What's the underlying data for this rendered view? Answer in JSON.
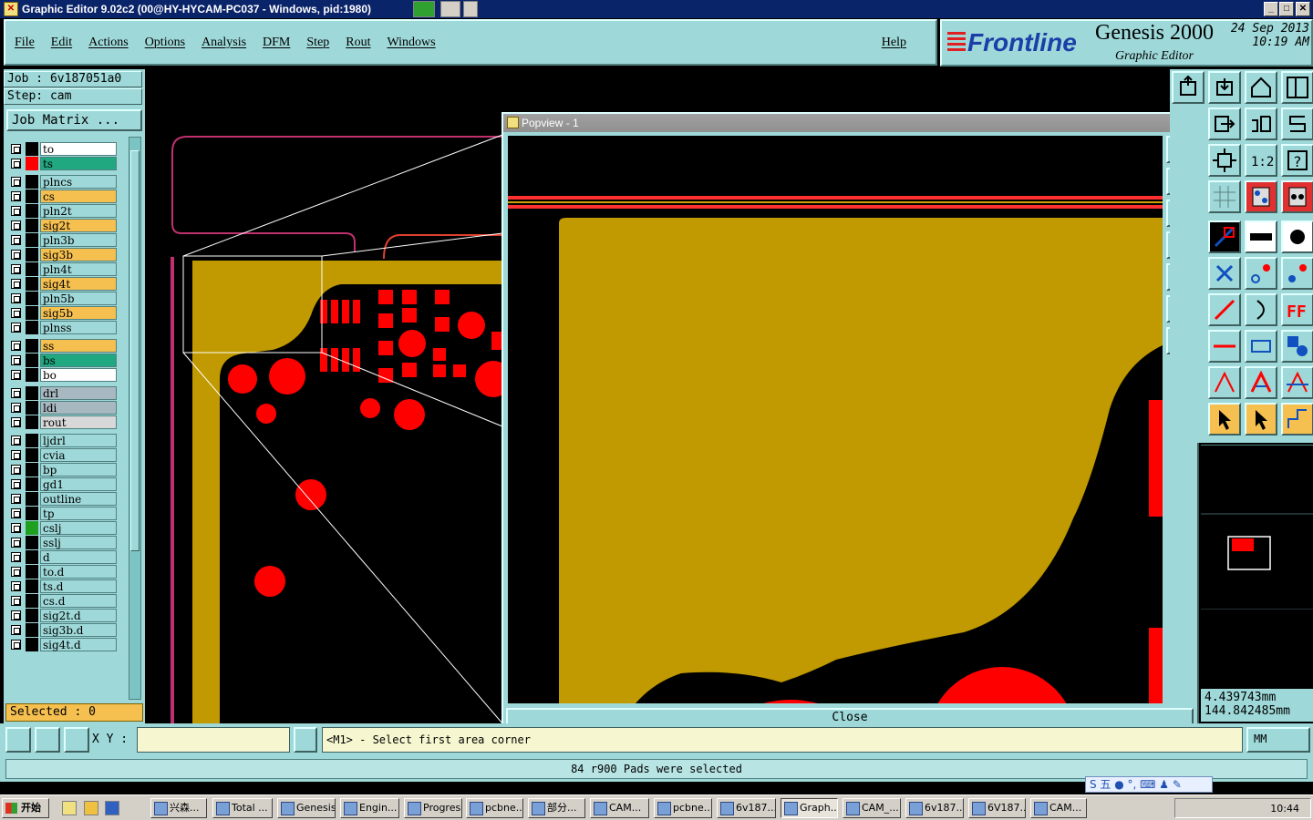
{
  "window": {
    "title": "Graphic Editor 9.02c2 (00@HY-HYCAM-PC037 - Windows, pid:1980)"
  },
  "menu": {
    "items": [
      "File",
      "Edit",
      "Actions",
      "Options",
      "Analysis",
      "DFM",
      "Step",
      "Rout",
      "Windows"
    ],
    "help": "Help"
  },
  "brand": {
    "logo": "Frontline",
    "product": "Genesis 2000",
    "subtitle": "Graphic Editor",
    "date": "24 Sep 2013",
    "time": "10:19 AM"
  },
  "job": {
    "job_label": "Job : 6v187051a0",
    "step_label": "Step: cam",
    "matrix_button": "Job Matrix ..."
  },
  "layers": [
    {
      "name": "to",
      "color": "#ffffff",
      "swatch": "#000000"
    },
    {
      "name": "ts",
      "color": "#20a880",
      "swatch": "#ff0000"
    },
    {
      "name": "plncs",
      "color": "#9ed8d8",
      "swatch": "#000000"
    },
    {
      "name": "cs",
      "color": "#f6c050",
      "swatch": "#000000"
    },
    {
      "name": "pln2t",
      "color": "#9ed8d8",
      "swatch": "#000000"
    },
    {
      "name": "sig2t",
      "color": "#f6c050",
      "swatch": "#000000"
    },
    {
      "name": "pln3b",
      "color": "#9ed8d8",
      "swatch": "#000000"
    },
    {
      "name": "sig3b",
      "color": "#f6c050",
      "swatch": "#000000"
    },
    {
      "name": "pln4t",
      "color": "#9ed8d8",
      "swatch": "#000000"
    },
    {
      "name": "sig4t",
      "color": "#f6c050",
      "swatch": "#000000"
    },
    {
      "name": "pln5b",
      "color": "#9ed8d8",
      "swatch": "#000000"
    },
    {
      "name": "sig5b",
      "color": "#f6c050",
      "swatch": "#000000"
    },
    {
      "name": "plnss",
      "color": "#9ed8d8",
      "swatch": "#000000"
    },
    {
      "name": "ss",
      "color": "#f6c050",
      "swatch": "#000000"
    },
    {
      "name": "bs",
      "color": "#20a880",
      "swatch": "#000000"
    },
    {
      "name": "bo",
      "color": "#ffffff",
      "swatch": "#000000"
    },
    {
      "name": "drl",
      "color": "#a8b8c0",
      "swatch": "#000000"
    },
    {
      "name": "ldi",
      "color": "#a8b8c0",
      "swatch": "#000000"
    },
    {
      "name": "rout",
      "color": "#d8d8d8",
      "swatch": "#000000"
    },
    {
      "name": "ljdrl",
      "color": "#9ed8d8",
      "swatch": "#000000"
    },
    {
      "name": "cvia",
      "color": "#9ed8d8",
      "swatch": "#000000"
    },
    {
      "name": "bp",
      "color": "#9ed8d8",
      "swatch": "#000000"
    },
    {
      "name": "gd1",
      "color": "#9ed8d8",
      "swatch": "#000000"
    },
    {
      "name": "outline",
      "color": "#9ed8d8",
      "swatch": "#000000"
    },
    {
      "name": "tp",
      "color": "#9ed8d8",
      "swatch": "#000000"
    },
    {
      "name": "cslj",
      "color": "#9ed8d8",
      "swatch": "#20a020"
    },
    {
      "name": "sslj",
      "color": "#9ed8d8",
      "swatch": "#000000"
    },
    {
      "name": "d",
      "color": "#9ed8d8",
      "swatch": "#000000"
    },
    {
      "name": "to.d",
      "color": "#9ed8d8",
      "swatch": "#000000"
    },
    {
      "name": "ts.d",
      "color": "#9ed8d8",
      "swatch": "#000000"
    },
    {
      "name": "cs.d",
      "color": "#9ed8d8",
      "swatch": "#000000"
    },
    {
      "name": "sig2t.d",
      "color": "#9ed8d8",
      "swatch": "#000000"
    },
    {
      "name": "sig3b.d",
      "color": "#9ed8d8",
      "swatch": "#000000"
    },
    {
      "name": "sig4t.d",
      "color": "#9ed8d8",
      "swatch": "#000000"
    }
  ],
  "selected": "Selected : 0",
  "popup": {
    "title": "Popview - 1",
    "close_x": "✕",
    "close_button": "Close"
  },
  "coords": {
    "x": "4.439743mm",
    "y": "144.842485mm"
  },
  "command": {
    "xy_label": "X Y :",
    "xy_value": "",
    "prompt": "<M1> - Select first area corner",
    "unit": "MM"
  },
  "status": {
    "message": "84 r900 Pads were selected"
  },
  "ime": "S 五 ● °,  ⌨ ♟ ✎",
  "taskbar": {
    "start": "开始",
    "tasks": [
      "兴森...",
      "Total ...",
      "Genesis",
      "Engin...",
      "Progress",
      "pcbne...",
      "部分...",
      "CAM...",
      "pcbne...",
      "6v187...",
      "Graph...",
      "CAM_...",
      "6v187...",
      "6V187...",
      "CAM..."
    ],
    "clock": "10:44"
  },
  "colors": {
    "panel": "#9ed8d8",
    "copper": "#c09a00",
    "pad": "#ff0000",
    "background": "#000000"
  }
}
